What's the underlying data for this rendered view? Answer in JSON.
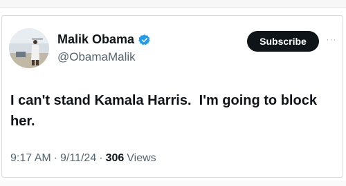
{
  "tweet": {
    "author": {
      "display_name": "Malik Obama",
      "handle": "@ObamaMalik",
      "verified": true
    },
    "subscribe_label": "Subscribe",
    "more_label": "···",
    "text": "I can't stand Kamala Harris.  I'm going to block her.",
    "time": "9:17 AM",
    "date": "9/11/24",
    "views_count": "306",
    "views_label": "Views",
    "separator": "·"
  },
  "colors": {
    "verified": "#1d9bf0",
    "subscribe_bg": "#0f1419",
    "secondary_text": "#536471"
  },
  "icons": {
    "verified": "verified-badge-icon",
    "more": "more-options-icon"
  }
}
